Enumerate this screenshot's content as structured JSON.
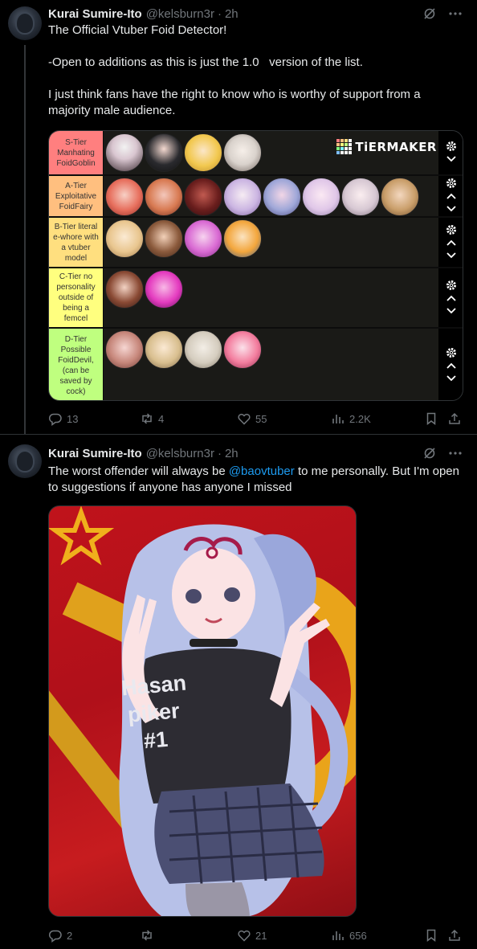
{
  "tweet1": {
    "name": "Kurai Sumire-Ito",
    "handle": "@kelsburn3r",
    "dot": "·",
    "time": "2h",
    "text_lines": [
      "The Official Vtuber Foid Detector!",
      "",
      "-Open to additions as this is just the 1.0   version of the list.",
      "",
      "I just think fans have the right to know who is worthy of support from a majority male audience."
    ],
    "tierlist": {
      "brand": "TiERMAKER",
      "tiers": [
        {
          "label": "S-Tier Manhating FoidGoblin",
          "color": "#ff7f7f",
          "count": 4
        },
        {
          "label": "A-Tier Exploitative FoidFairy",
          "color": "#ffbf7f",
          "count": 8
        },
        {
          "label": "B-Tier literal e-whore with a vtuber model",
          "color": "#ffdf7f",
          "count": 4
        },
        {
          "label": "C-Tier no personality outside of being a femcel",
          "color": "#ffff7f",
          "count": 2
        },
        {
          "label": "D-Tier Possible FoidDevil, (can be saved by cock)",
          "color": "#bfff7f",
          "count": 4
        }
      ]
    },
    "actions": {
      "replies": "13",
      "reposts": "4",
      "likes": "55",
      "views": "2.2K"
    }
  },
  "tweet2": {
    "name": "Kurai Sumire-Ito",
    "handle": "@kelsburn3r",
    "dot": "·",
    "time": "2h",
    "text_before": "The worst offender will always be ",
    "mention": "@baovtuber",
    "text_after": " to me personally. But I'm open to suggestions if anyone has anyone I missed",
    "shirt_lines": [
      "Hasan",
      "piker",
      "#1"
    ],
    "actions": {
      "replies": "2",
      "reposts": "",
      "likes": "21",
      "views": "656"
    }
  },
  "icons": {
    "grok": "grok-icon",
    "more": "more-icon",
    "reply": "reply-icon",
    "repost": "repost-icon",
    "like": "heart-icon",
    "views": "views-icon",
    "bookmark": "bookmark-icon",
    "share": "share-icon"
  },
  "colors": {
    "accent": "#1d9bf0",
    "muted": "#71767b",
    "text": "#e7e9ea"
  }
}
